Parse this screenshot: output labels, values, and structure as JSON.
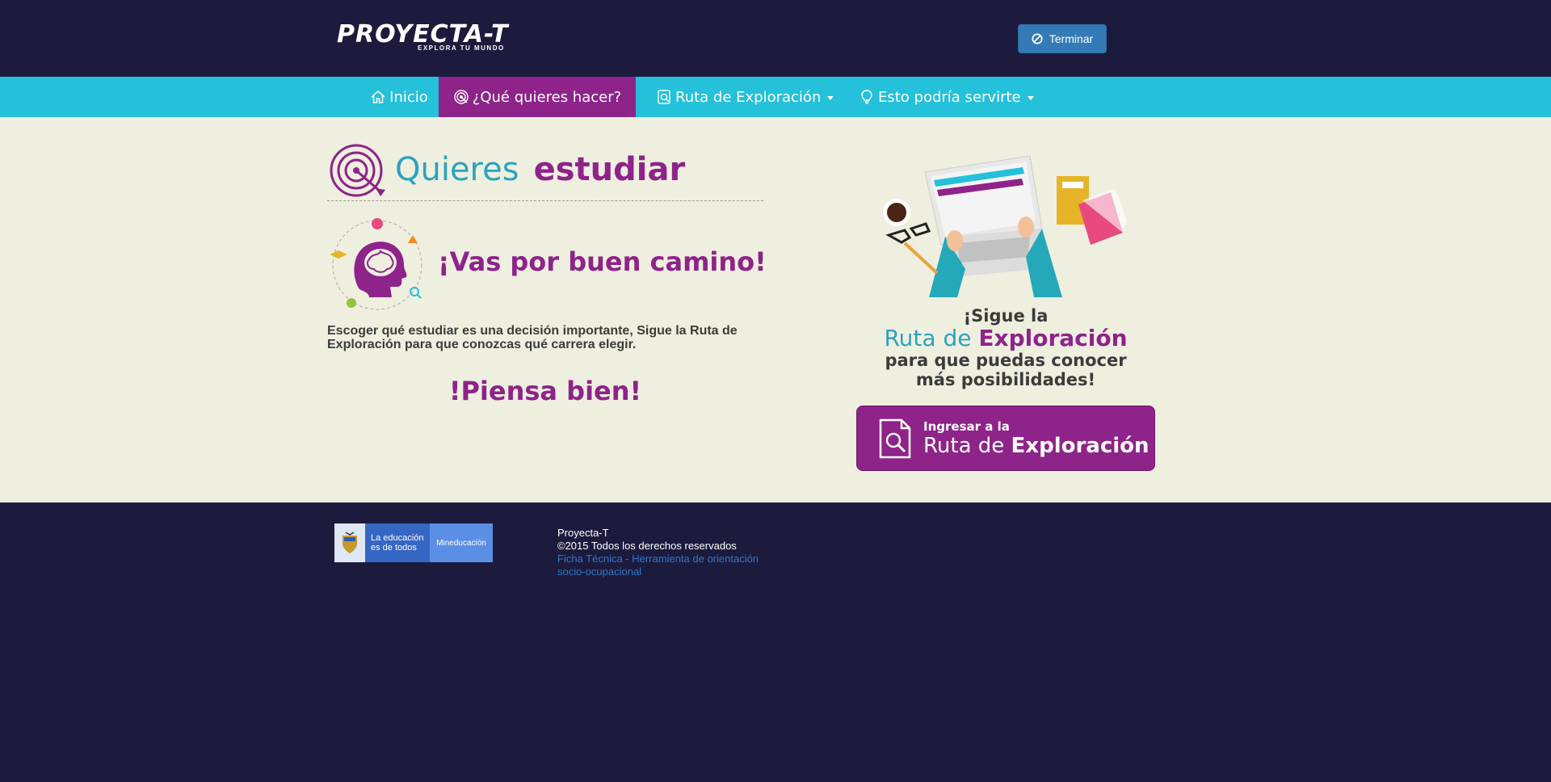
{
  "header": {
    "logo_main": "PROYECTA-T",
    "logo_sub": "EXPLORA TU MUNDO",
    "end_button": "Terminar"
  },
  "nav": {
    "items": [
      {
        "label": "Inicio",
        "icon": "home-icon"
      },
      {
        "label": "¿Qué quieres hacer?",
        "icon": "target-icon"
      },
      {
        "label": "Ruta de Exploración",
        "icon": "search-doc-icon"
      },
      {
        "label": "Esto podría servirte",
        "icon": "lightbulb-icon"
      }
    ]
  },
  "main": {
    "title_light": "Quieres",
    "title_bold": "estudiar",
    "subtitle": "¡Vas por buen camino!",
    "description": "Escoger qué estudiar es una decisión importante, Sigue la Ruta de Exploración para que conozcas qué carrera elegir.",
    "closing": "!Piensa bien!",
    "promo": {
      "line1": "¡Sigue la",
      "line2_light": "Ruta de",
      "line2_bold": "Exploración",
      "line3": "para que puedas conocer",
      "line4": "más posibilidades!"
    },
    "cta": {
      "small": "Ingresar a la",
      "big_light": "Ruta de",
      "big_bold": "Exploración"
    }
  },
  "footer": {
    "gov_logo_text": "La educación es de todos",
    "gov_logo_brand": "Mineducación",
    "site_name": "Proyecta-T",
    "copyright": "©2015 Todos los derechos reservados",
    "link": "Ficha Técnica - Herramienta de orientación socio-ocupacional"
  },
  "colors": {
    "header_bg": "#1c1b3d",
    "nav_bg": "#25c0d9",
    "active_nav": "#8e2389",
    "content_bg": "#efefe0",
    "accent_teal": "#2ba3be",
    "accent_purple": "#8e2389"
  }
}
